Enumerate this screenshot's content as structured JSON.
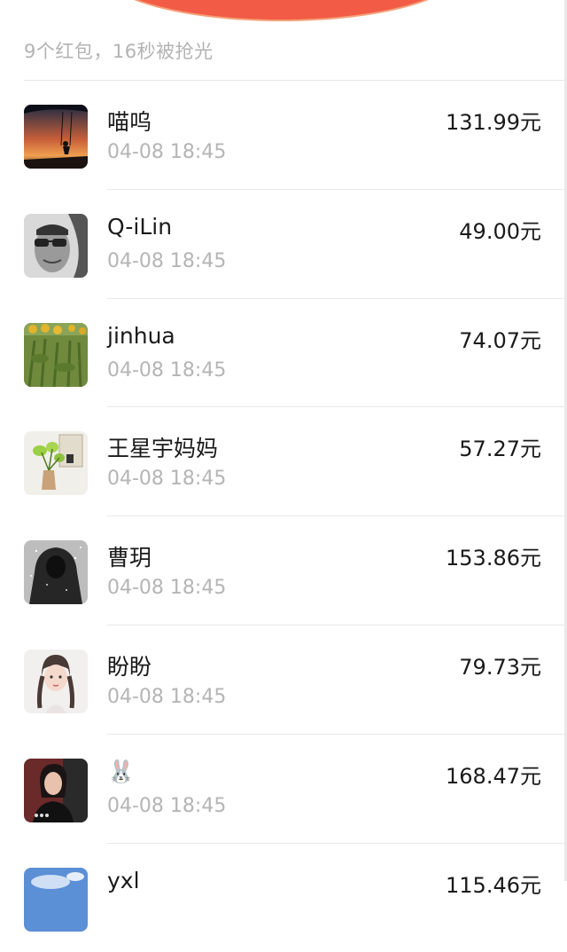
{
  "summary": "9个红包，16秒被抢光",
  "records": [
    {
      "name": "喵呜",
      "time": "04-08 18:45",
      "amount": "131.99元",
      "avatar": "sunset-swing-photo"
    },
    {
      "name": "Q-iLin",
      "time": "04-08 18:45",
      "amount": "49.00元",
      "avatar": "man-sunglasses-photo"
    },
    {
      "name": "jinhua",
      "time": "04-08 18:45",
      "amount": "74.07元",
      "avatar": "sunflower-field-photo"
    },
    {
      "name": "王星宇妈妈",
      "time": "04-08 18:45",
      "amount": "57.27元",
      "avatar": "plant-vase-photo"
    },
    {
      "name": "曹玥",
      "time": "04-08 18:45",
      "amount": "153.86元",
      "avatar": "hooded-figure-snow-photo"
    },
    {
      "name": "盼盼",
      "time": "04-08 18:45",
      "amount": "79.73元",
      "avatar": "girl-braids-photo"
    },
    {
      "name": "🐰",
      "time": "04-08 18:45",
      "amount": "168.47元",
      "avatar": "woman-portrait-photo"
    },
    {
      "name": "yxl",
      "time": "",
      "amount": "115.46元",
      "avatar": "blue-sky-photo"
    }
  ]
}
